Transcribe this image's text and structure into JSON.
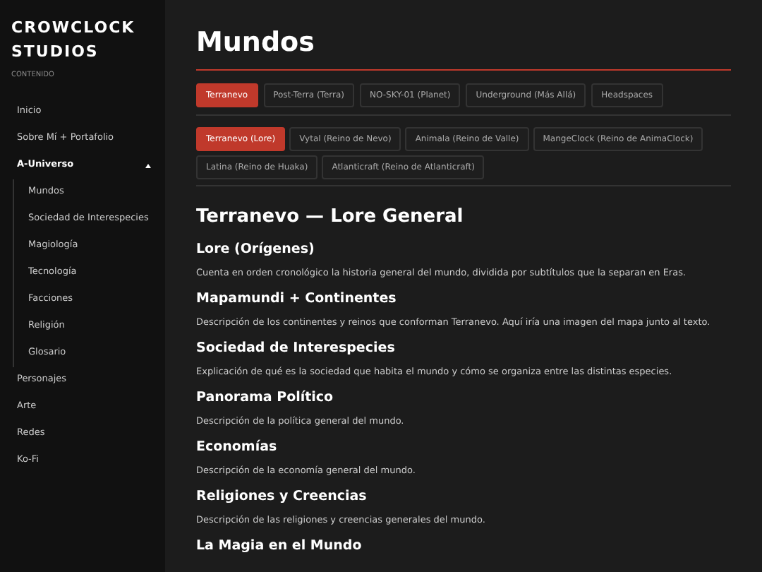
{
  "sidebar": {
    "brand": "CROWCLOCK STUDIOS",
    "section_label": "CONTENIDO",
    "items": [
      {
        "label": "Inicio"
      },
      {
        "label": "Sobre Mí + Portafolio"
      },
      {
        "label": "A-Universo",
        "expanded": true,
        "children": [
          {
            "label": "Mundos"
          },
          {
            "label": "Sociedad de Interespecies"
          },
          {
            "label": "Magiología"
          },
          {
            "label": "Tecnología"
          },
          {
            "label": "Facciones"
          },
          {
            "label": "Religión"
          },
          {
            "label": "Glosario"
          }
        ]
      },
      {
        "label": "Personajes"
      },
      {
        "label": "Arte"
      },
      {
        "label": "Redes"
      },
      {
        "label": "Ko-Fi"
      }
    ]
  },
  "page_title": "Mundos",
  "world_tabs": [
    {
      "label": "Terranevo",
      "selected": true
    },
    {
      "label": "Post-Terra (Terra)",
      "selected": false
    },
    {
      "label": "NO-SKY-01 (Planet)",
      "selected": false
    },
    {
      "label": "Underground (Más Allá)",
      "selected": false
    },
    {
      "label": "Headspaces",
      "selected": false
    }
  ],
  "sub_tabs": [
    {
      "label": "Terranevo (Lore)",
      "selected": true
    },
    {
      "label": "Vytal (Reino de Nevo)",
      "selected": false
    },
    {
      "label": "Animala (Reino de Valle)",
      "selected": false
    },
    {
      "label": "MangeClock (Reino de AnimaClock)",
      "selected": false
    },
    {
      "label": "Latina (Reino de Huaka)",
      "selected": false
    },
    {
      "label": "Atlanticraft (Reino de Atlanticraft)",
      "selected": false
    }
  ],
  "article": {
    "title": "Terranevo — Lore General",
    "sections": [
      {
        "heading": "Lore (Orígenes)",
        "text": "Cuenta en orden cronológico la historia general del mundo, dividida por subtítulos que la separan en Eras."
      },
      {
        "heading": "Mapamundi + Continentes",
        "text": "Descripción de los continentes y reinos que conforman Terranevo. Aquí iría una imagen del mapa junto al texto."
      },
      {
        "heading": "Sociedad de Interespecies",
        "text": "Explicación de qué es la sociedad que habita el mundo y cómo se organiza entre las distintas especies."
      },
      {
        "heading": "Panorama Político",
        "text": "Descripción de la política general del mundo."
      },
      {
        "heading": "Economías",
        "text": "Descripción de la economía general del mundo."
      },
      {
        "heading": "Religiones y Creencias",
        "text": "Descripción de las religiones y creencias generales del mundo."
      },
      {
        "heading": "La Magia en el Mundo"
      }
    ]
  }
}
